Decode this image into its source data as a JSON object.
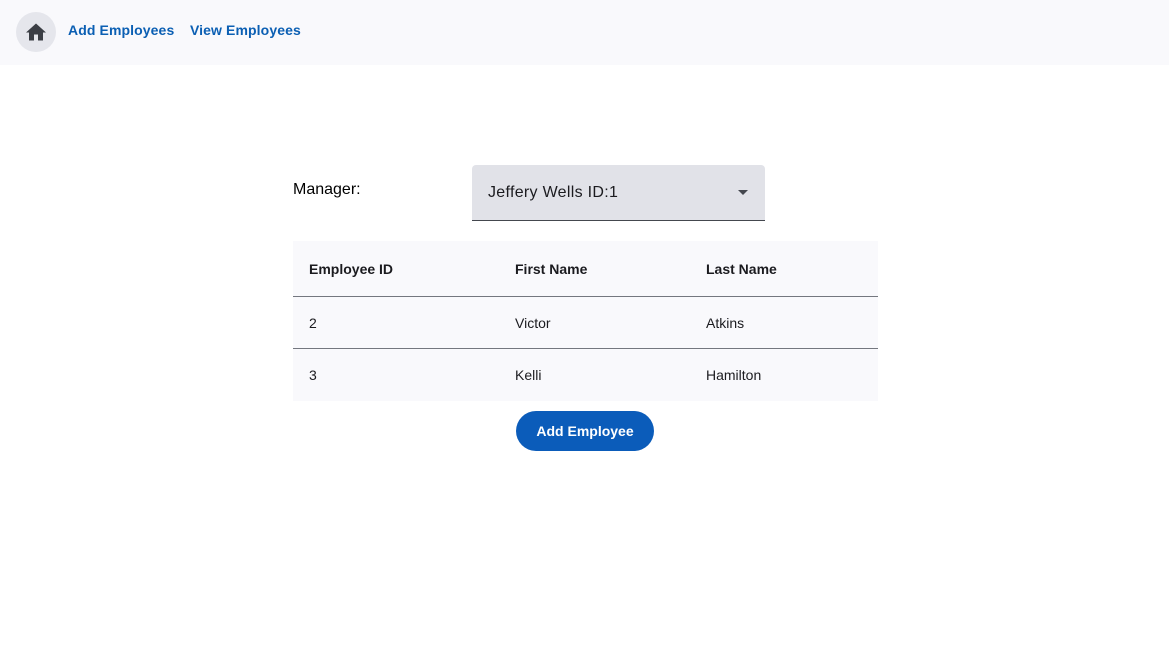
{
  "nav": {
    "home_icon": "home-icon",
    "links": [
      "Add Employees",
      "View Employees"
    ]
  },
  "form": {
    "manager_label": "Manager:",
    "manager_selected": "Jeffery Wells ID:1"
  },
  "table": {
    "columns": [
      "Employee ID",
      "First Name",
      "Last Name"
    ],
    "rows": [
      [
        "2",
        "Victor",
        "Atkins"
      ],
      [
        "3",
        "Kelli",
        "Hamilton"
      ]
    ]
  },
  "actions": {
    "add_employee_label": "Add Employee"
  },
  "colors": {
    "accent": "#0b5cba",
    "nav_link": "#0b5fb3",
    "toolbar_bg": "#f9f9fc",
    "select_bg": "#e1e2e8"
  }
}
